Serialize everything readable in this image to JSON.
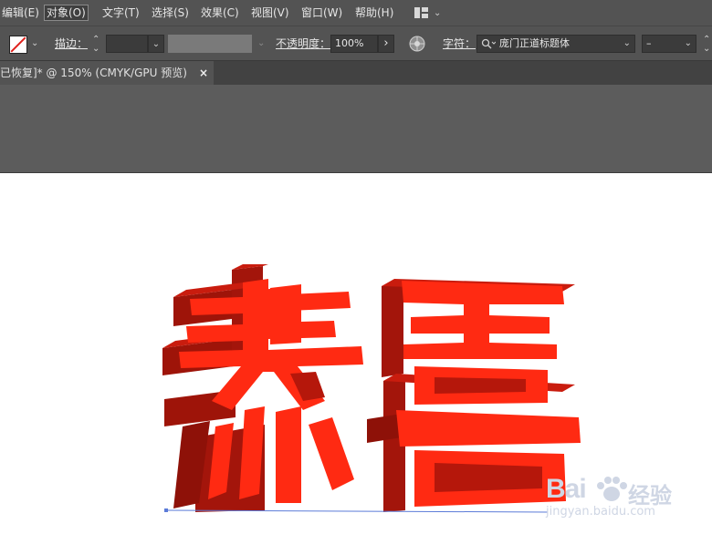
{
  "menubar": {
    "items": [
      {
        "label": "编辑(E)"
      },
      {
        "label": "对象(O)"
      },
      {
        "label": "文字(T)"
      },
      {
        "label": "选择(S)"
      },
      {
        "label": "效果(C)"
      },
      {
        "label": "视图(V)"
      },
      {
        "label": "窗口(W)"
      },
      {
        "label": "帮助(H)"
      }
    ],
    "active_item": "对象(O)"
  },
  "controlbar": {
    "stroke_label": "描边：",
    "stroke_value": "",
    "opacity_label": "不透明度：",
    "opacity_value": "100%",
    "char_label": "字符：",
    "font_value": "庞门正道标题体",
    "font_style_value": "–",
    "chevron": "⌄",
    "arrow_right": "›"
  },
  "tab": {
    "title": "已恢复]* @ 150% (CMYK/GPU 预览)",
    "close": "×"
  },
  "artwork": {
    "text": "恭喜",
    "face_color": "#ff2a12",
    "side_color": "#a8120a",
    "extrude_color": "#c41a0d"
  },
  "watermark": {
    "brand": "Bai",
    "jy": "经验",
    "url": "jingyan.baidu.com"
  }
}
